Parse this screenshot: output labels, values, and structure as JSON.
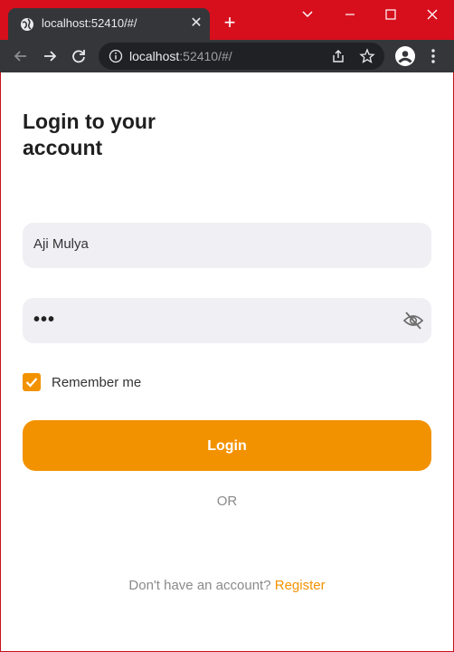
{
  "browser": {
    "tab_title": "localhost:52410/#/",
    "url_host": "localhost",
    "url_path": ":52410/#/"
  },
  "page": {
    "title": "Login to your account",
    "username_value": "Aji Mulya",
    "password_masked": "•••",
    "remember_label": "Remember me",
    "remember_checked": true,
    "login_label": "Login",
    "or_label": "OR",
    "register_prompt": "Don't have an account?",
    "register_link": "Register"
  },
  "colors": {
    "accent": "#f39200",
    "field_bg": "#efeff4",
    "frame": "#d70f1d"
  },
  "icons": {
    "favicon": "globe-icon",
    "back": "arrow-left-icon",
    "forward": "arrow-right-icon",
    "reload": "reload-icon",
    "info": "info-icon",
    "share": "share-icon",
    "star": "star-icon",
    "profile": "profile-icon",
    "menu": "kebab-menu-icon",
    "eye": "eye-off-icon",
    "check": "check-icon"
  }
}
